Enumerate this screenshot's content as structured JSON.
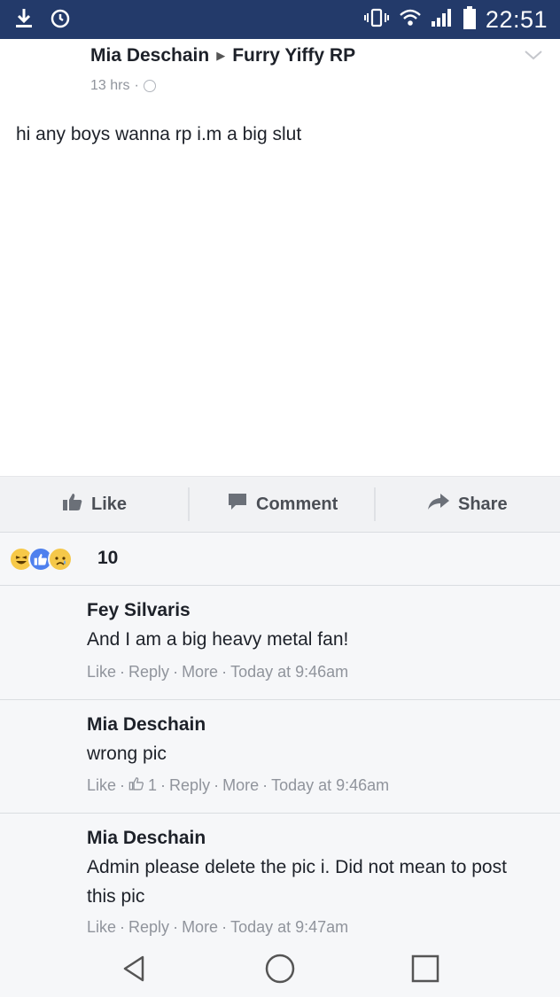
{
  "status_bar": {
    "time": "22:51",
    "left_icons": [
      "download-icon",
      "alarm-icon"
    ],
    "right_icons": [
      "vibrate-icon",
      "wifi-icon",
      "signal-icon",
      "battery-icon"
    ]
  },
  "post": {
    "author": "Mia Deschain",
    "group": "Furry Yiffy RP",
    "time": "13 hrs",
    "meta_sep": "·",
    "text": "hi any boys wanna rp i.m a big slut"
  },
  "actions": {
    "like": "Like",
    "comment": "Comment",
    "share": "Share"
  },
  "reactions": {
    "count": "10",
    "icons": [
      "haha-reaction-icon",
      "like-reaction-icon",
      "sad-reaction-icon"
    ]
  },
  "comments": [
    {
      "author": "Fey Silvaris",
      "text": "And I am a big heavy metal fan!",
      "like": "Like",
      "reply": "Reply",
      "more": "More",
      "time": "Today at 9:46am"
    },
    {
      "author": "Mia Deschain",
      "text": "wrong pic",
      "like": "Like",
      "likes_count": "1",
      "reply": "Reply",
      "more": "More",
      "time": "Today at 9:46am"
    },
    {
      "author": "Mia Deschain",
      "text": "Admin please delete the pic i. Did not mean to post this pic",
      "like": "Like",
      "reply": "Reply",
      "more": "More",
      "time": "Today at 9:47am"
    }
  ],
  "nav_bar": {
    "buttons": [
      "back-icon",
      "home-icon",
      "recents-icon"
    ]
  },
  "colors": {
    "status_bar": "#233a6a",
    "text_primary": "#1d2129",
    "text_secondary": "#90949c",
    "like_blue": "#4e80ee"
  }
}
